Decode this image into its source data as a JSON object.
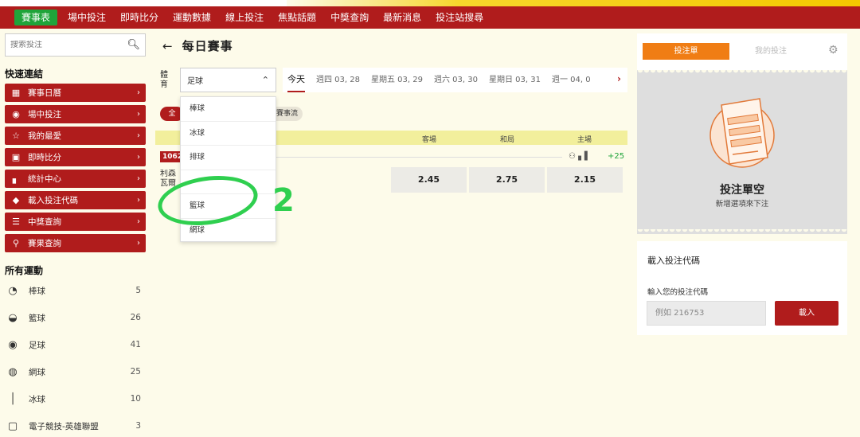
{
  "nav": {
    "items": [
      "賽事表",
      "場中投注",
      "即時比分",
      "運動數據",
      "線上投注",
      "焦點話題",
      "中獎查詢",
      "最新消息",
      "投注站搜尋"
    ]
  },
  "sidebar": {
    "search_placeholder": "搜索投注",
    "quick_links_title": "快速連結",
    "quick_links": [
      {
        "label": "賽事日曆",
        "icon": "calendar-icon"
      },
      {
        "label": "場中投注",
        "icon": "live-icon"
      },
      {
        "label": "我的最愛",
        "icon": "star-icon"
      },
      {
        "label": "即時比分",
        "icon": "scoreboard-icon"
      },
      {
        "label": "統計中心",
        "icon": "stats-icon"
      },
      {
        "label": "載入投注代碼",
        "icon": "tag-icon"
      },
      {
        "label": "中獎查詢",
        "icon": "clipboard-icon"
      },
      {
        "label": "賽果查詢",
        "icon": "search-icon"
      }
    ],
    "sports_title": "所有運動",
    "sports": [
      {
        "label": "棒球",
        "count": "5",
        "icon": "baseball-icon"
      },
      {
        "label": "籃球",
        "count": "26",
        "icon": "basketball-icon"
      },
      {
        "label": "足球",
        "count": "41",
        "icon": "soccer-icon"
      },
      {
        "label": "網球",
        "count": "25",
        "icon": "tennis-icon"
      },
      {
        "label": "冰球",
        "count": "10",
        "icon": "hockey-icon"
      },
      {
        "label": "電子競技-英雄聯盟",
        "count": "3",
        "icon": "gamepad-icon"
      }
    ]
  },
  "main": {
    "title": "每日賽事",
    "sport_label": "體育",
    "sport_selected": "足球",
    "dates": [
      "今天",
      "週四 03, 28",
      "星期五 03, 29",
      "週六 03, 30",
      "星期日 03, 31",
      "週一 04, 0"
    ],
    "filter_all": "全",
    "filter_other": "賽事流",
    "table_headers": {
      "away": "客場",
      "draw": "和局",
      "home": "主場"
    },
    "match": {
      "id": "1062",
      "team_line1": "利森",
      "team_line2": "瓦爾",
      "more": "+25",
      "odds": [
        "2.45",
        "2.75",
        "2.15"
      ]
    },
    "dropdown_options": [
      "棒球",
      "冰球",
      "排球",
      "",
      "籃球",
      "網球"
    ]
  },
  "annotation": {
    "number": "2",
    "color": "#2fcf4f"
  },
  "betslip": {
    "tab_active": "投注單",
    "tab_other": "我的投注",
    "empty_title": "投注單空",
    "empty_sub": "新增選項來下注"
  },
  "code_panel": {
    "title": "載入投注代碼",
    "subtitle": "輸入您的投注代碼",
    "placeholder": "例如 216753",
    "button": "載入"
  },
  "colors": {
    "brand_red": "#b01c1c",
    "accent_green": "#1fa43a",
    "orange": "#f07d14",
    "yellow": "#f4c800"
  }
}
